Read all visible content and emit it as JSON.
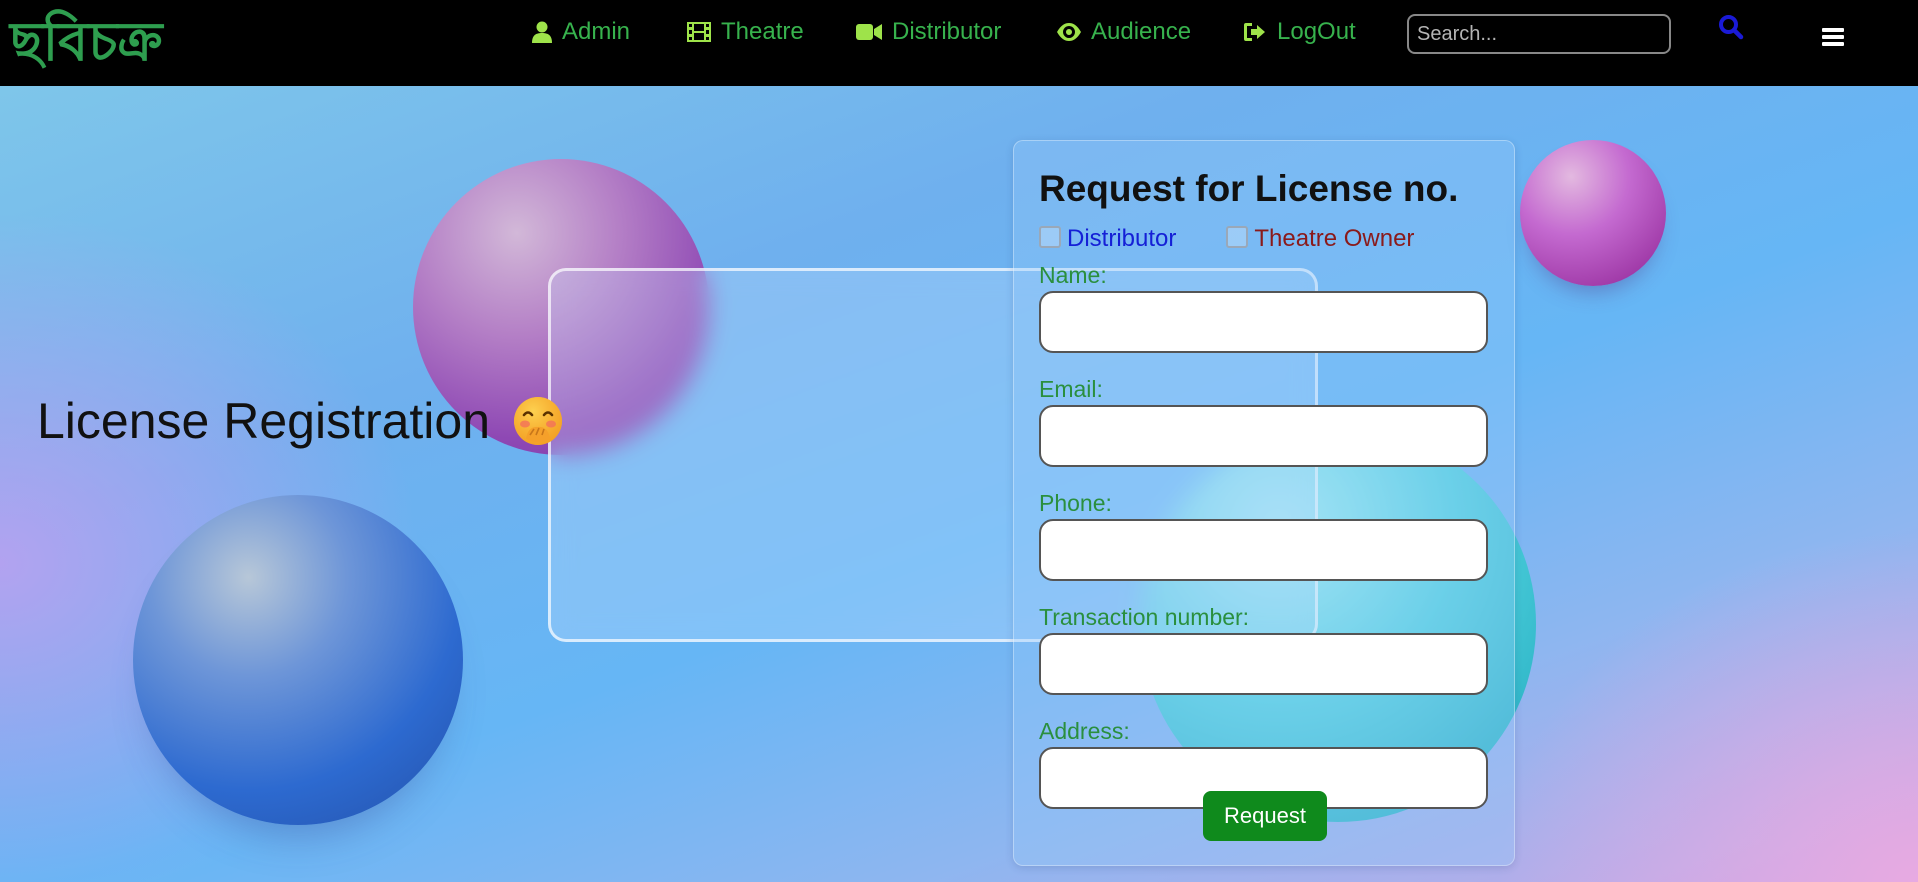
{
  "navbar": {
    "logo": "ছবিচক্র",
    "items": [
      {
        "label": "Admin",
        "icon": "user-icon"
      },
      {
        "label": "Theatre",
        "icon": "film-icon"
      },
      {
        "label": "Distributor",
        "icon": "video-camera-icon"
      },
      {
        "label": "Audience",
        "icon": "eye-icon"
      },
      {
        "label": "LogOut",
        "icon": "sign-out-icon"
      }
    ],
    "search_placeholder": "Search...",
    "search_icon": "search-icon",
    "menu_icon": "hamburger-menu-icon"
  },
  "hero": {
    "title": "License Registration",
    "emoji": "🤭"
  },
  "form": {
    "title": "Request for License no.",
    "checkboxes": [
      {
        "label": "Distributor",
        "checked": false
      },
      {
        "label": "Theatre Owner",
        "checked": false
      }
    ],
    "fields": [
      {
        "label": "Name:",
        "value": ""
      },
      {
        "label": "Email:",
        "value": ""
      },
      {
        "label": "Phone:",
        "value": ""
      },
      {
        "label": "Transaction number:",
        "value": ""
      },
      {
        "label": "Address:",
        "value": ""
      }
    ],
    "submit_label": "Request"
  },
  "colors": {
    "nav_link": "#37b24d",
    "nav_icon": "#9ee34a",
    "logo": "#2e9e4f",
    "search_icon": "#1a1ad6",
    "field_label": "#2a8f3e",
    "distributor_label": "#1520d6",
    "theatre_owner_label": "#8a1a1a",
    "request_button": "#0f8a1c"
  }
}
